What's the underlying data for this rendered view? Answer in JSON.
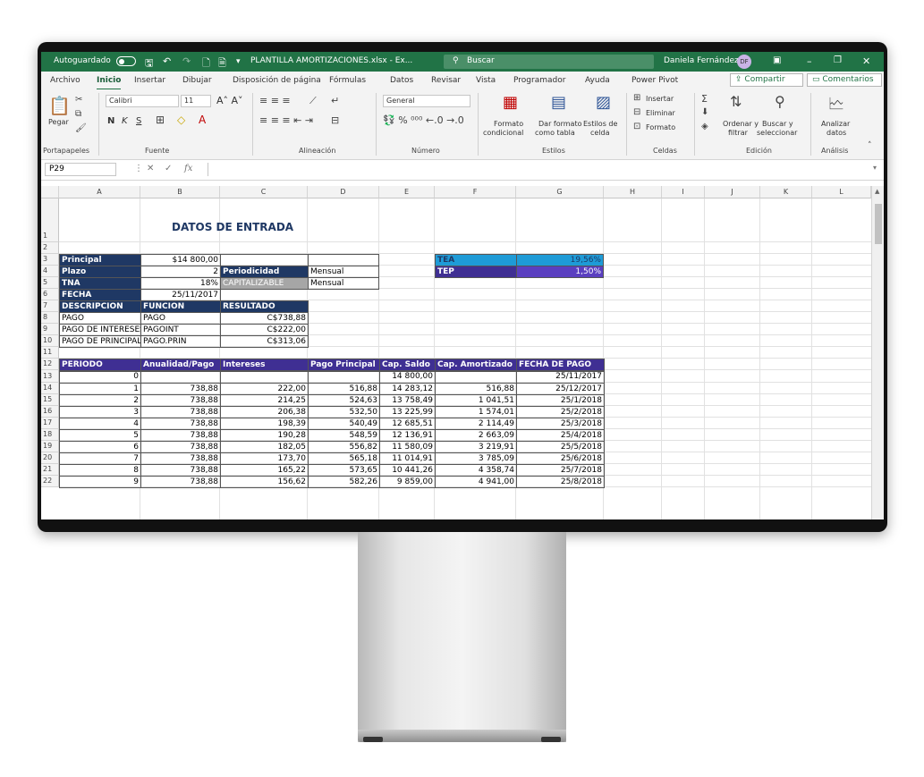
{
  "title_bar": {
    "autosave_label": "Autoguardado",
    "file_title": "PLANTILLA AMORTIZACIONES.xlsx - Ex...",
    "search_placeholder": "Buscar",
    "user_name": "Daniela Fernández",
    "user_initials": "DF"
  },
  "tabs": [
    "Archivo",
    "Inicio",
    "Insertar",
    "Dibujar",
    "Disposición de página",
    "Fórmulas",
    "Datos",
    "Revisar",
    "Vista",
    "Programador",
    "Ayuda",
    "Power Pivot"
  ],
  "share_label": "Compartir",
  "comments_label": "Comentarios",
  "ribbon": {
    "paste_label": "Pegar",
    "clipboard_group": "Portapapeles",
    "font_name": "Calibri",
    "font_size": "11",
    "bold": "N",
    "italic": "K",
    "underline": "S",
    "font_group": "Fuente",
    "align_group": "Alineación",
    "number_format": "General",
    "number_group": "Número",
    "cond_format": "Formato",
    "cond_format2": "condicional",
    "table_format": "Dar formato",
    "table_format2": "como tabla",
    "cell_styles": "Estilos de",
    "cell_styles2": "celda",
    "styles_group": "Estilos",
    "insert_label": "Insertar",
    "delete_label": "Eliminar",
    "format_label": "Formato",
    "cells_group": "Celdas",
    "sort_label": "Ordenar y",
    "sort_label2": "filtrar",
    "find_label": "Buscar y",
    "find_label2": "seleccionar",
    "edit_group": "Edición",
    "analyze_label": "Analizar",
    "analyze_label2": "datos",
    "analysis_group": "Análisis"
  },
  "name_box": "P29",
  "columns": [
    "A",
    "B",
    "C",
    "D",
    "E",
    "F",
    "G",
    "H",
    "I",
    "J",
    "K",
    "L"
  ],
  "rows": [
    "1",
    "2",
    "3",
    "4",
    "5",
    "6",
    "7",
    "8",
    "9",
    "10",
    "11",
    "12",
    "13",
    "14",
    "15",
    "16",
    "17",
    "18",
    "19",
    "20",
    "21",
    "22"
  ],
  "sheet": {
    "title": "DATOS DE ENTRADA",
    "inputs": {
      "principal_label": "Principal",
      "principal_value": "$14 800,00",
      "plazo_label": "Plazo",
      "plazo_value": "2",
      "periodicidad_label": "Periodicidad",
      "periodicidad_value": "Mensual",
      "tna_label": "TNA",
      "tna_value": "18%",
      "capitalizable_label": "CAPITALIZABLE",
      "capitalizable_value": "Mensual",
      "fecha_label": "FECHA",
      "fecha_value": "25/11/2017",
      "tea_label": "TEA",
      "tea_value": "19,56%",
      "tep_label": "TEP",
      "tep_value": "1,50%"
    },
    "functions": {
      "headers": [
        "DESCRIPCION",
        "FUNCION",
        "RESULTADO"
      ],
      "rows": [
        [
          "PAGO",
          "PAGO",
          "C$738,88"
        ],
        [
          "PAGO DE INTERESES",
          "PAGOINT",
          "C$222,00"
        ],
        [
          "PAGO DE PRINCIPAL",
          "PAGO.PRIN",
          "C$313,06"
        ]
      ]
    },
    "amort": {
      "headers": [
        "PERIODO",
        "Anualidad/Pago",
        "Intereses",
        "Pago Principal",
        "Cap. Saldo",
        "Cap. Amortizado",
        "FECHA DE PAGO"
      ],
      "rows": [
        [
          "0",
          "",
          "",
          "",
          "14 800,00",
          "",
          "25/11/2017"
        ],
        [
          "1",
          "738,88",
          "222,00",
          "516,88",
          "14 283,12",
          "516,88",
          "25/12/2017"
        ],
        [
          "2",
          "738,88",
          "214,25",
          "524,63",
          "13 758,49",
          "1 041,51",
          "25/1/2018"
        ],
        [
          "3",
          "738,88",
          "206,38",
          "532,50",
          "13 225,99",
          "1 574,01",
          "25/2/2018"
        ],
        [
          "4",
          "738,88",
          "198,39",
          "540,49",
          "12 685,51",
          "2 114,49",
          "25/3/2018"
        ],
        [
          "5",
          "738,88",
          "190,28",
          "548,59",
          "12 136,91",
          "2 663,09",
          "25/4/2018"
        ],
        [
          "6",
          "738,88",
          "182,05",
          "556,82",
          "11 580,09",
          "3 219,91",
          "25/5/2018"
        ],
        [
          "7",
          "738,88",
          "173,70",
          "565,18",
          "11 014,91",
          "3 785,09",
          "25/6/2018"
        ],
        [
          "8",
          "738,88",
          "165,22",
          "573,65",
          "10 441,26",
          "4 358,74",
          "25/7/2018"
        ],
        [
          "9",
          "738,88",
          "156,62",
          "582,26",
          "9 859,00",
          "4 941,00",
          "25/8/2018"
        ]
      ]
    }
  },
  "colors": {
    "excel_green": "#217346",
    "navy": "#1f3864",
    "purple": "#3f2f93",
    "tea_bg": "#1e9bd7",
    "tep_bg": "#5a3fc0"
  }
}
